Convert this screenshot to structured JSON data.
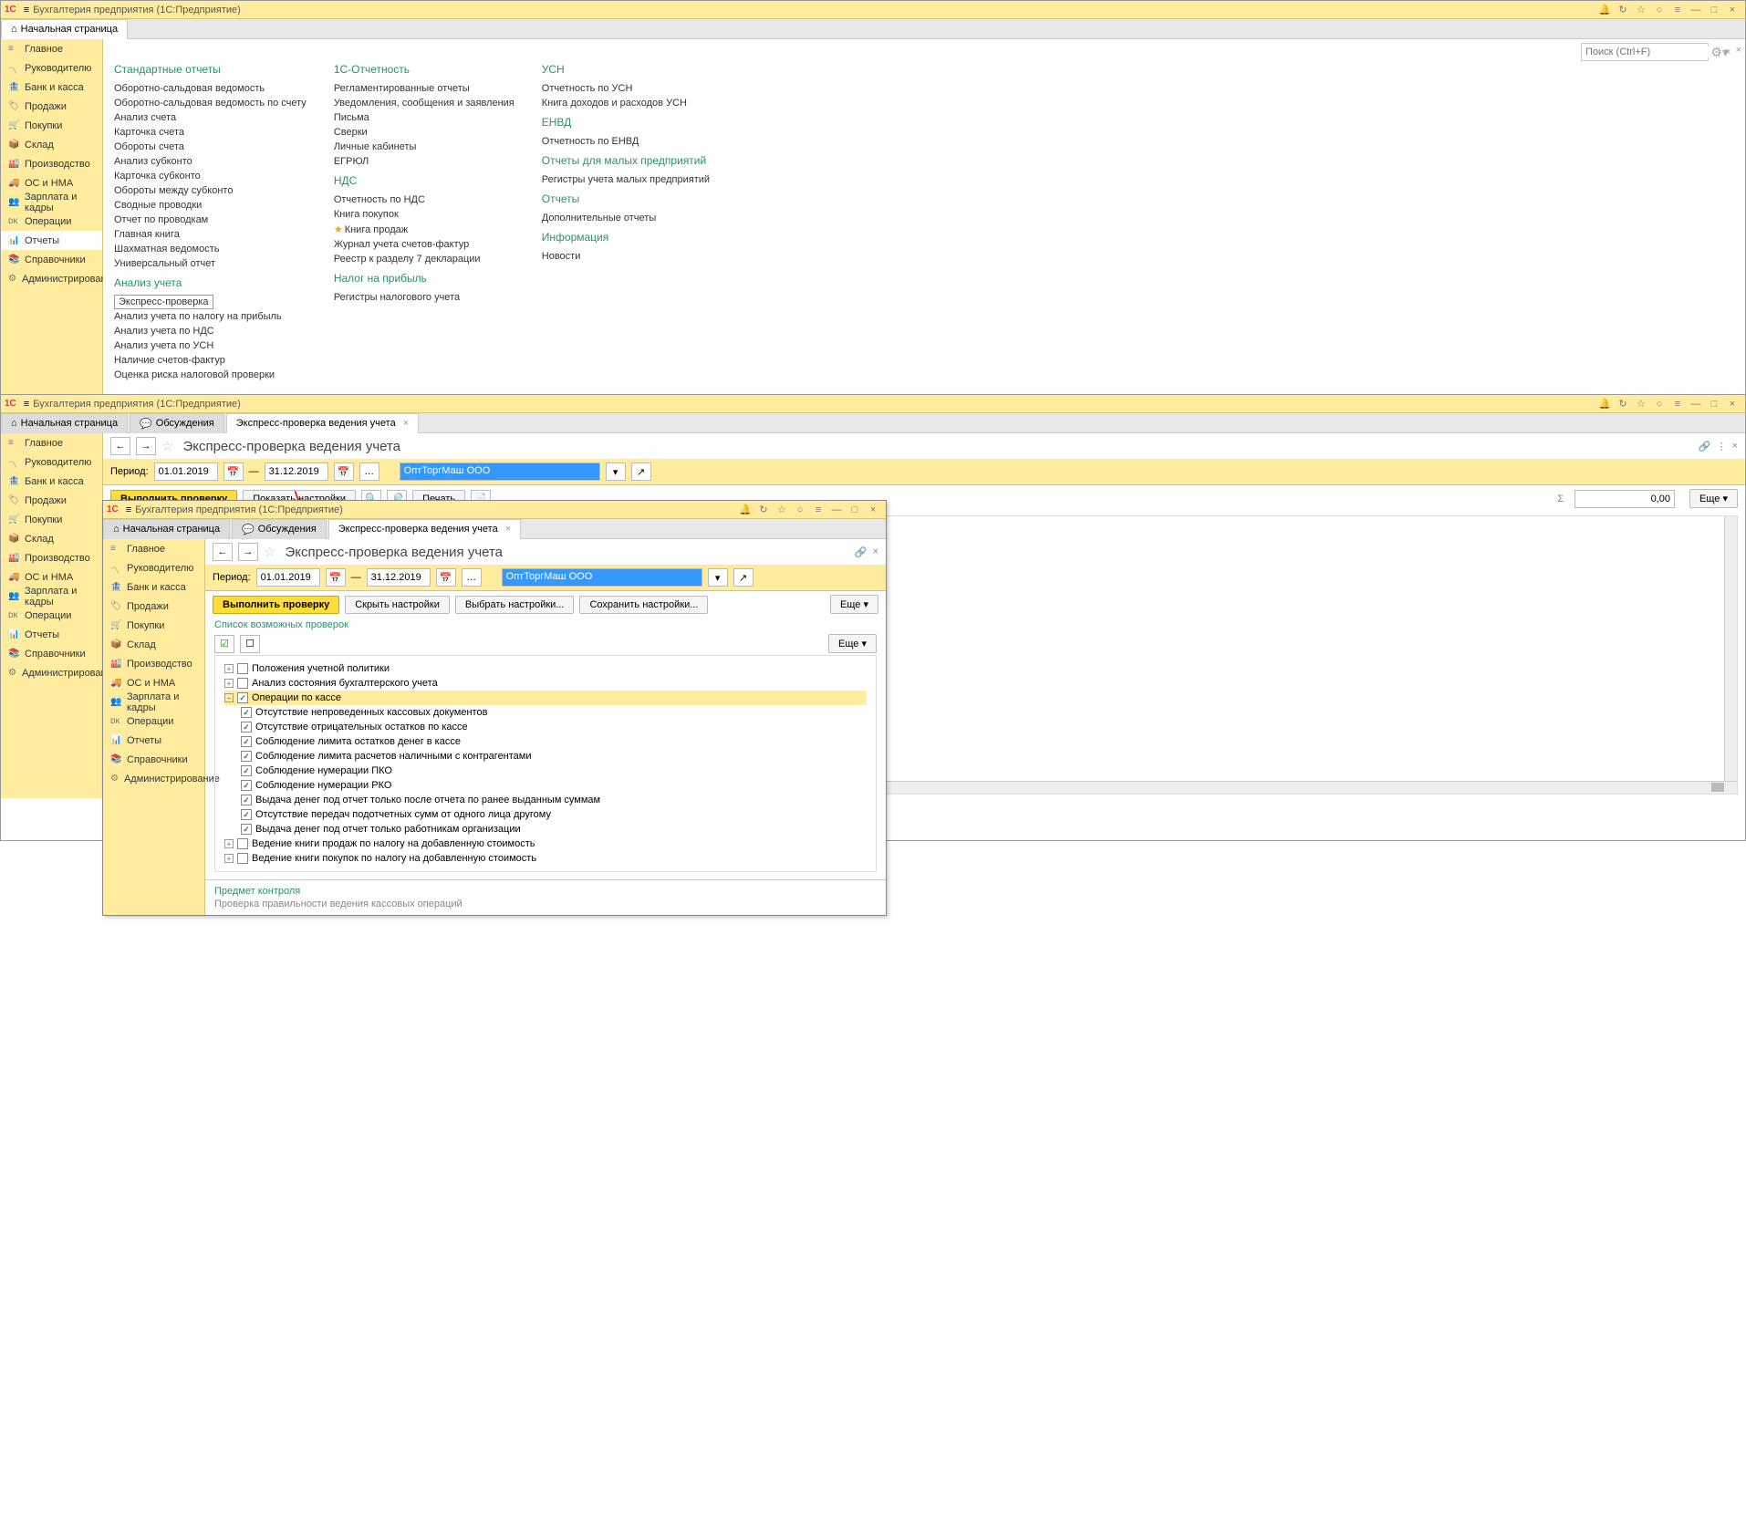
{
  "topWindow": {
    "appTitle": "Бухгалтерия предприятия  (1С:Предприятие)",
    "searchPlaceholder": "Поиск (Ctrl+F)",
    "tabs": {
      "home": "Начальная страница"
    },
    "sidebar": [
      "Главное",
      "Руководителю",
      "Банк и касса",
      "Продажи",
      "Покупки",
      "Склад",
      "Производство",
      "ОС и НМА",
      "Зарплата и кадры",
      "Операции",
      "Отчеты",
      "Справочники",
      "Администрирование"
    ],
    "sections": {
      "std": {
        "h": "Стандартные отчеты",
        "items": [
          "Оборотно-сальдовая ведомость",
          "Оборотно-сальдовая ведомость по счету",
          "Анализ счета",
          "Карточка счета",
          "Обороты счета",
          "Анализ субконто",
          "Карточка субконто",
          "Обороты между субконто",
          "Сводные проводки",
          "Отчет по проводкам",
          "Главная книга",
          "Шахматная ведомость",
          "Универсальный отчет"
        ]
      },
      "analysis": {
        "h": "Анализ учета",
        "items": [
          "Экспресс-проверка",
          "Анализ учета по налогу на прибыль",
          "Анализ учета по НДС",
          "Анализ учета по УСН",
          "Наличие счетов-фактур",
          "Оценка риска налоговой проверки"
        ]
      },
      "reporting": {
        "h": "1С-Отчетность",
        "items": [
          "Регламентированные отчеты",
          "Уведомления, сообщения и заявления",
          "Письма",
          "Сверки",
          "Личные кабинеты",
          "ЕГРЮЛ"
        ]
      },
      "vat": {
        "h": "НДС",
        "items": [
          "Отчетность по НДС",
          "Книга покупок",
          "Книга продаж",
          "Журнал учета счетов-фактур",
          "Реестр к разделу 7 декларации"
        ]
      },
      "profit": {
        "h": "Налог на прибыль",
        "items": [
          "Регистры налогового учета"
        ]
      },
      "usn": {
        "h": "УСН",
        "items": [
          "Отчетность по УСН",
          "Книга доходов и расходов УСН"
        ]
      },
      "envd": {
        "h": "ЕНВД",
        "items": [
          "Отчетность по ЕНВД"
        ]
      },
      "small": {
        "h": "Отчеты для малых предприятий",
        "items": [
          "Регистры учета малых предприятий"
        ]
      },
      "reports": {
        "h": "Отчеты",
        "items": [
          "Дополнительные отчеты"
        ]
      },
      "info": {
        "h": "Информация",
        "items": [
          "Новости"
        ]
      }
    }
  },
  "midWindow": {
    "appTitle": "Бухгалтерия предприятия  (1С:Предприятие)",
    "tabs": {
      "home": "Начальная страница",
      "discuss": "Обсуждения",
      "express": "Экспресс-проверка ведения учета"
    },
    "pageTitle": "Экспресс-проверка ведения учета",
    "periodLabel": "Период:",
    "dateFrom": "01.01.2019",
    "dateTo": "31.12.2019",
    "org": "ОптТоргМаш ООО",
    "btnRun": "Выполнить проверку",
    "btnShowSettings": "Показать настройки",
    "btnPrint": "Печать",
    "sum": "0,00",
    "btnMore": "Еще"
  },
  "innerWindow": {
    "appTitle": "Бухгалтерия предприятия  (1С:Предприятие)",
    "tabs": {
      "home": "Начальная страница",
      "discuss": "Обсуждения",
      "express": "Экспресс-проверка ведения учета"
    },
    "pageTitle": "Экспресс-проверка ведения учета",
    "periodLabel": "Период:",
    "dateFrom": "01.01.2019",
    "dateTo": "31.12.2019",
    "org": "ОптТоргМаш ООО",
    "btnRun": "Выполнить проверку",
    "btnHideSettings": "Скрыть настройки",
    "btnChoose": "Выбрать настройки...",
    "btnSave": "Сохранить настройки...",
    "btnMore": "Еще",
    "listTitle": "Список возможных проверок",
    "tree": {
      "n0": "Положения учетной политики",
      "n1": "Анализ состояния бухгалтерского учета",
      "n2": "Операции по кассе",
      "n2c": [
        "Отсутствие непроведенных кассовых документов",
        "Отсутствие отрицательных остатков по кассе",
        "Соблюдение лимита остатков денег в кассе",
        "Соблюдение лимита расчетов наличными с контрагентами",
        "Соблюдение нумерации ПКО",
        "Соблюдение нумерации РКО",
        "Выдача денег под отчет только после отчета по ранее выданным суммам",
        "Отсутствие передач подотчетных сумм от одного лица другому",
        "Выдача денег под отчет только работникам организации"
      ],
      "n3": "Ведение книги продаж по налогу на добавленную стоимость",
      "n4": "Ведение книги покупок по налогу на добавленную стоимость"
    },
    "subjectH": "Предмет контроля",
    "subjectText": "Проверка правильности ведения кассовых операций"
  }
}
